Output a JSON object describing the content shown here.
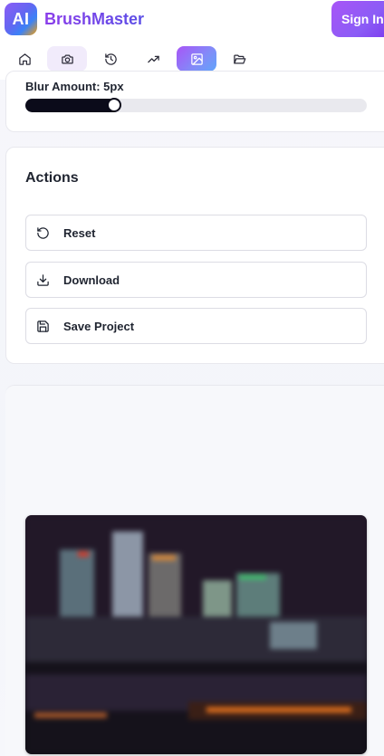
{
  "header": {
    "logo_text": "AI",
    "brand": "BrushMaster",
    "signin_label": "Sign In"
  },
  "nav": {
    "items": [
      {
        "icon": "home-icon",
        "state": "default"
      },
      {
        "icon": "camera-icon",
        "state": "hover"
      },
      {
        "icon": "history-icon",
        "state": "default"
      },
      {
        "icon": "trending-up-icon",
        "state": "default"
      },
      {
        "icon": "image-icon",
        "state": "active"
      },
      {
        "icon": "folder-open-icon",
        "state": "default"
      }
    ]
  },
  "blur": {
    "label": "Blur Amount: 5px",
    "value": 5,
    "fill_fraction": 0.26
  },
  "actions": {
    "title": "Actions",
    "buttons": [
      {
        "label": "Reset",
        "icon": "rotate-ccw-icon"
      },
      {
        "label": "Download",
        "icon": "download-icon"
      },
      {
        "label": "Save Project",
        "icon": "save-icon"
      }
    ]
  },
  "colors": {
    "brand_gradient_start": "#8b3dea",
    "brand_gradient_end": "#5b4fe6",
    "accent": "#a855f7",
    "slider_fill": "#0b0b1a"
  }
}
